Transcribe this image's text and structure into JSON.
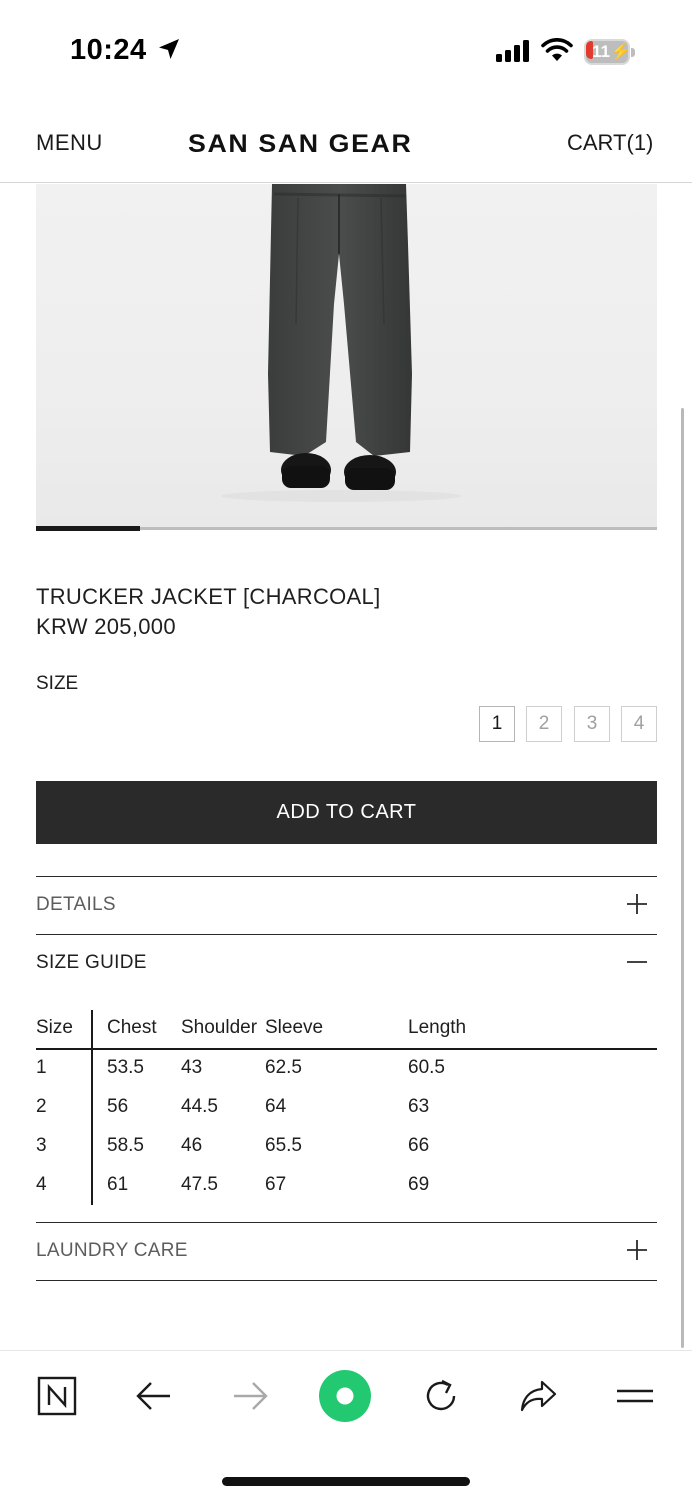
{
  "status_bar": {
    "time": "10:24",
    "battery_percent": "11",
    "battery_color": "#e23b2e"
  },
  "header": {
    "menu_label": "MENU",
    "brand": "SAN SAN GEAR",
    "cart_label": "CART(1)"
  },
  "gallery": {
    "slide_index": 1,
    "slide_count": 6
  },
  "product": {
    "name": "TRUCKER JACKET [CHARCOAL]",
    "price": "KRW 205,000",
    "size_label": "SIZE",
    "sizes": [
      "1",
      "2",
      "3",
      "4"
    ],
    "selected_size": "1",
    "add_to_cart_label": "ADD TO CART"
  },
  "accordion": {
    "details_label": "DETAILS",
    "size_guide_label": "SIZE GUIDE",
    "laundry_label": "LAUNDRY CARE"
  },
  "size_guide": {
    "headers": [
      "Size",
      "Chest",
      "Shoulder",
      "Sleeve",
      "Length"
    ],
    "rows": [
      [
        "1",
        "53.5",
        "43",
        "62.5",
        "60.5"
      ],
      [
        "2",
        "56",
        "44.5",
        "64",
        "63"
      ],
      [
        "3",
        "58.5",
        "46",
        "65.5",
        "66"
      ],
      [
        "4",
        "61",
        "47.5",
        "67",
        "69"
      ]
    ]
  },
  "browser_toolbar": {
    "icons": [
      "naver-n-icon",
      "back-arrow-icon",
      "forward-arrow-icon",
      "green-circle-icon",
      "reload-icon",
      "share-icon",
      "menu-lines-icon"
    ],
    "accent_color": "#22c971"
  }
}
